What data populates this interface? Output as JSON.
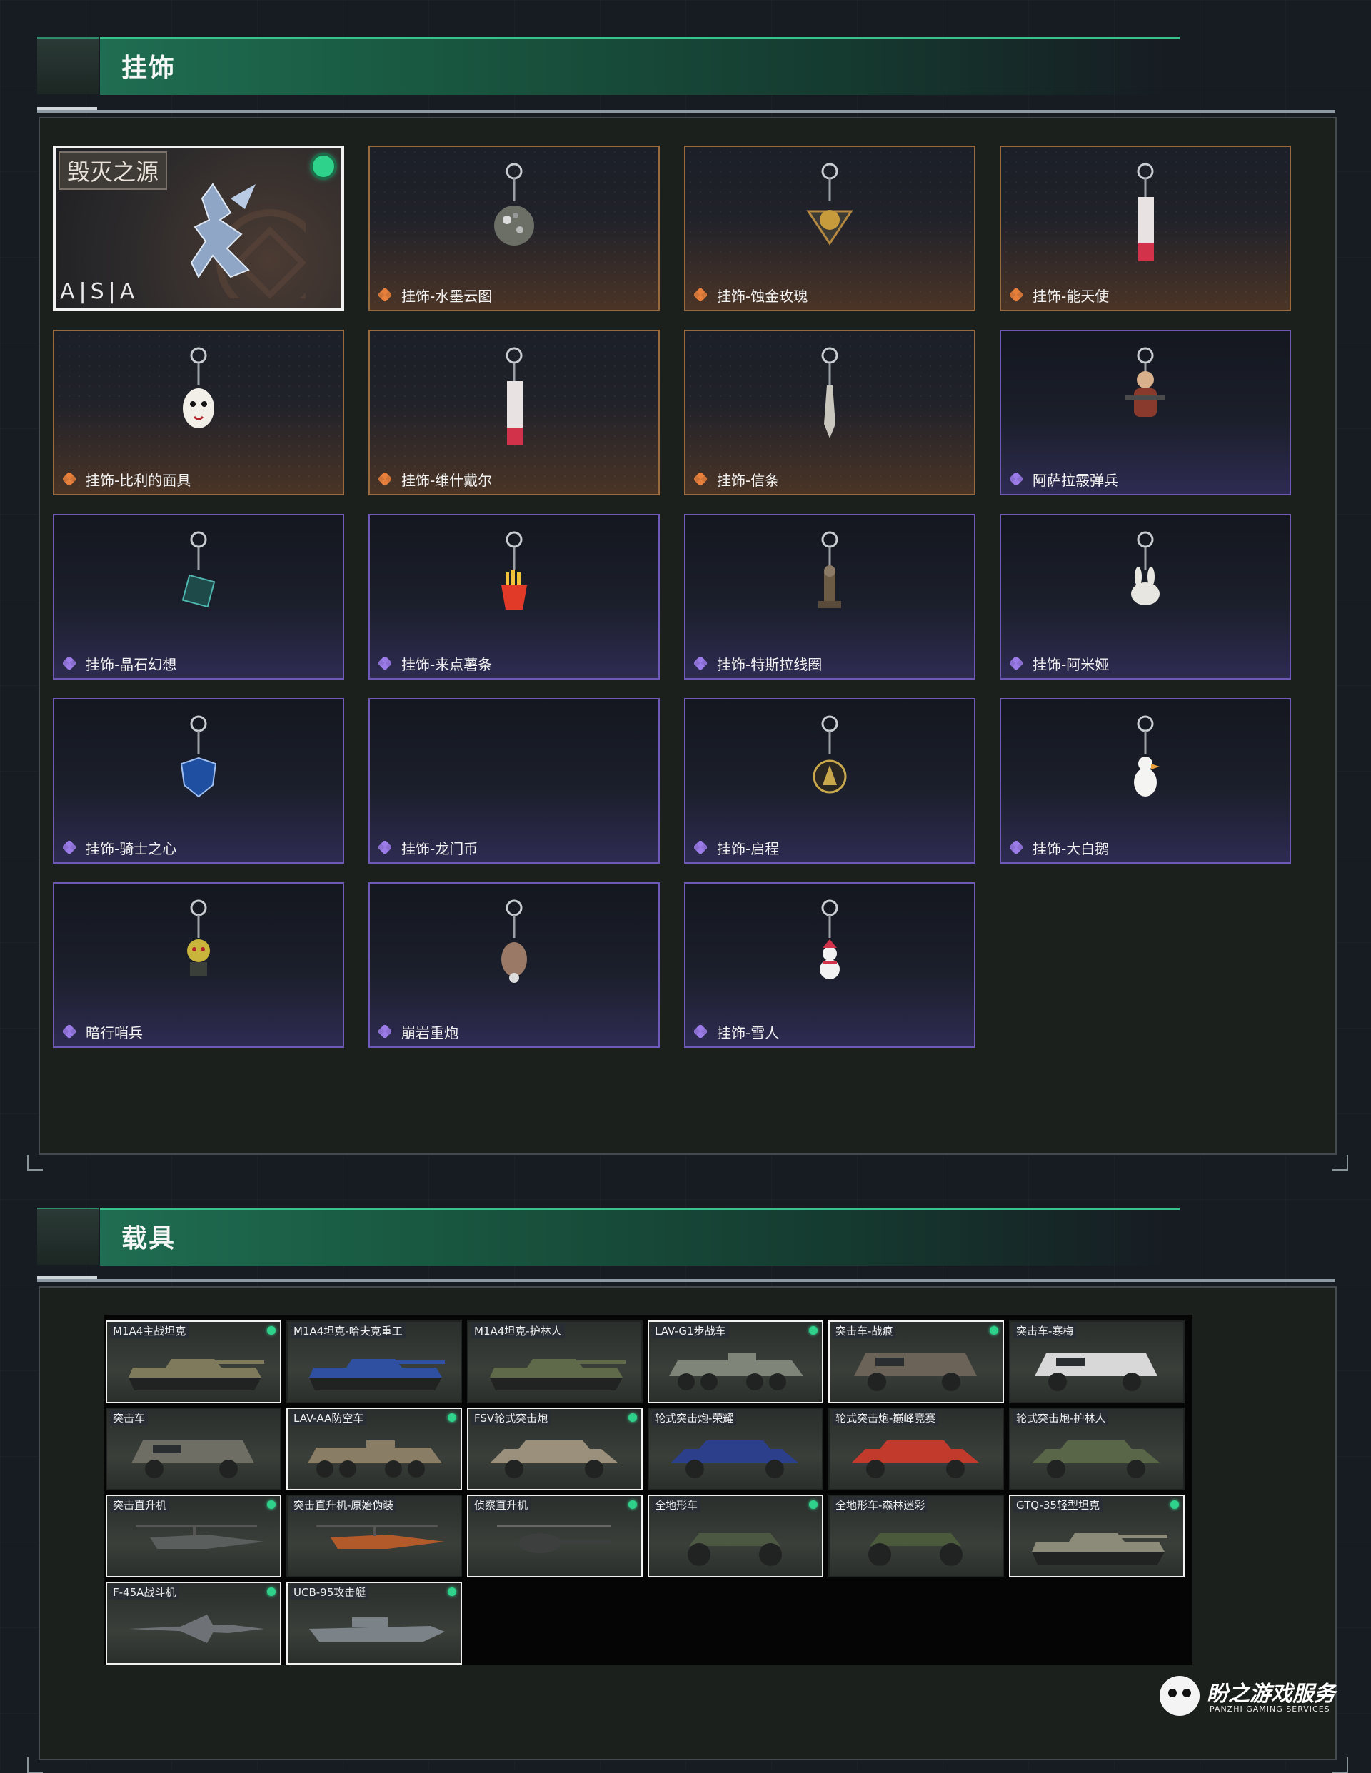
{
  "sections": {
    "pendants": {
      "title": "挂饰"
    },
    "vehicles": {
      "title": "载具"
    }
  },
  "featured": {
    "name": "毁灭之源",
    "brand_text": "A|S|A",
    "owned": true
  },
  "pendants": [
    {
      "label": "挂饰-水墨云图",
      "rarity": "gold",
      "icon": "orb-pendant-icon"
    },
    {
      "label": "挂饰-蚀金玫瑰",
      "rarity": "gold",
      "icon": "rose-pendant-icon"
    },
    {
      "label": "挂饰-能天使",
      "rarity": "gold",
      "icon": "tag-pendant-icon"
    },
    {
      "label": "挂饰-比利的面具",
      "rarity": "gold",
      "icon": "mask-pendant-icon"
    },
    {
      "label": "挂饰-维什戴尔",
      "rarity": "gold",
      "icon": "tag-pendant-icon"
    },
    {
      "label": "挂饰-信条",
      "rarity": "gold",
      "icon": "blade-pendant-icon"
    },
    {
      "label": "阿萨拉霰弹兵",
      "rarity": "purple",
      "icon": "soldier-pendant-icon"
    },
    {
      "label": "挂饰-晶石幻想",
      "rarity": "purple",
      "icon": "cube-pendant-icon"
    },
    {
      "label": "挂饰-来点薯条",
      "rarity": "purple",
      "icon": "fries-pendant-icon"
    },
    {
      "label": "挂饰-特斯拉线圈",
      "rarity": "purple",
      "icon": "coil-pendant-icon"
    },
    {
      "label": "挂饰-阿米娅",
      "rarity": "purple",
      "icon": "bunny-pendant-icon"
    },
    {
      "label": "挂饰-骑士之心",
      "rarity": "purple",
      "icon": "shield-pendant-icon"
    },
    {
      "label": "挂饰-龙门币",
      "rarity": "purple",
      "icon": "coin-pendant-icon"
    },
    {
      "label": "挂饰-启程",
      "rarity": "purple",
      "icon": "medal-pendant-icon"
    },
    {
      "label": "挂饰-大白鹅",
      "rarity": "purple",
      "icon": "goose-pendant-icon"
    },
    {
      "label": "暗行哨兵",
      "rarity": "purple",
      "icon": "sentinel-pendant-icon"
    },
    {
      "label": "崩岩重炮",
      "rarity": "purple",
      "icon": "cannon-pendant-icon"
    },
    {
      "label": "挂饰-雪人",
      "rarity": "purple",
      "icon": "snowman-pendant-icon"
    }
  ],
  "vehicles": [
    {
      "label": "M1A4主战坦克",
      "selected": true,
      "owned": true,
      "kind": "tank",
      "color": "#7f7a5c"
    },
    {
      "label": "M1A4坦克-哈夫克重工",
      "selected": false,
      "owned": false,
      "kind": "tank",
      "color": "#2f4fa0"
    },
    {
      "label": "M1A4坦克-护林人",
      "selected": false,
      "owned": false,
      "kind": "tank",
      "color": "#5f6a4a"
    },
    {
      "label": "LAV-G1步战车",
      "selected": true,
      "owned": true,
      "kind": "ifv",
      "color": "#80857a"
    },
    {
      "label": "突击车-战痕",
      "selected": true,
      "owned": true,
      "kind": "truck",
      "color": "#6b6258"
    },
    {
      "label": "突击车-寒梅",
      "selected": false,
      "owned": false,
      "kind": "truck",
      "color": "#d8d8d8"
    },
    {
      "label": "突击车",
      "selected": false,
      "owned": false,
      "kind": "truck",
      "color": "#6e6e64"
    },
    {
      "label": "LAV-AA防空车",
      "selected": true,
      "owned": true,
      "kind": "ifv",
      "color": "#8a7d66"
    },
    {
      "label": "FSV轮式突击炮",
      "selected": true,
      "owned": true,
      "kind": "buggy",
      "color": "#9a907c"
    },
    {
      "label": "轮式突击炮-荣耀",
      "selected": false,
      "owned": false,
      "kind": "buggy",
      "color": "#2c3f8a"
    },
    {
      "label": "轮式突击炮-巅峰竞赛",
      "selected": false,
      "owned": false,
      "kind": "buggy",
      "color": "#c23a2c"
    },
    {
      "label": "轮式突击炮-护林人",
      "selected": false,
      "owned": false,
      "kind": "buggy",
      "color": "#5a6648"
    },
    {
      "label": "突击直升机",
      "selected": true,
      "owned": true,
      "kind": "heli",
      "color": "#5a5e5c"
    },
    {
      "label": "突击直升机-原始伪装",
      "selected": false,
      "owned": false,
      "kind": "heli",
      "color": "#b35a2a"
    },
    {
      "label": "侦察直升机",
      "selected": true,
      "owned": true,
      "kind": "scout",
      "color": "#3c3f3e"
    },
    {
      "label": "全地形车",
      "selected": true,
      "owned": true,
      "kind": "atv",
      "color": "#4d5842"
    },
    {
      "label": "全地形车-森林迷彩",
      "selected": false,
      "owned": false,
      "kind": "atv",
      "color": "#4c5a3c"
    },
    {
      "label": "GTQ-35轻型坦克",
      "selected": true,
      "owned": true,
      "kind": "tank",
      "color": "#8c8a78"
    },
    {
      "label": "F-45A战斗机",
      "selected": true,
      "owned": true,
      "kind": "jet",
      "color": "#6e7276"
    },
    {
      "label": "UCB-95攻击艇",
      "selected": true,
      "owned": true,
      "kind": "boat",
      "color": "#7c8388"
    }
  ],
  "watermark": {
    "name": "盼之游戏服务",
    "subtitle": "PANZHI GAMING SERVICES"
  },
  "colors": {
    "accent_green": "#38c28e",
    "rarity_gold": "#e8803c",
    "rarity_purple": "#9b7be8"
  }
}
